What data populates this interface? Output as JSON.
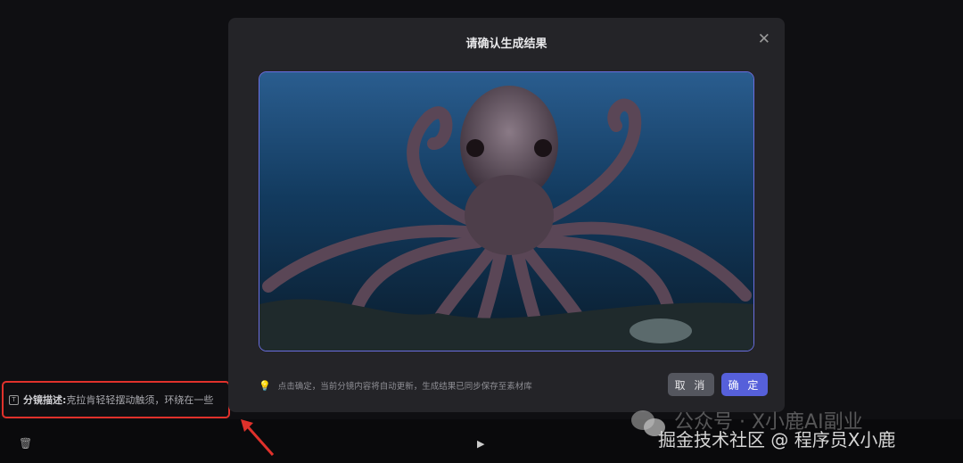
{
  "modal": {
    "title": "请确认生成结果",
    "close_icon": "close-icon",
    "hint": "点击确定，当前分镜内容将自动更新，生成结果已同步保存至素材库",
    "cancel_label": "取 消",
    "confirm_label": "确 定"
  },
  "storyboard": {
    "desc_label": "分镜描述:",
    "desc_text": "克拉肯轻轻摆动触须，环绕在一些"
  },
  "watermark": {
    "line1": "公众号 · X小鹿AI副业",
    "line2": "掘金技术社区 @ 程序员X小鹿"
  },
  "colors": {
    "accent": "#5660da",
    "annotation": "#e0312b"
  }
}
